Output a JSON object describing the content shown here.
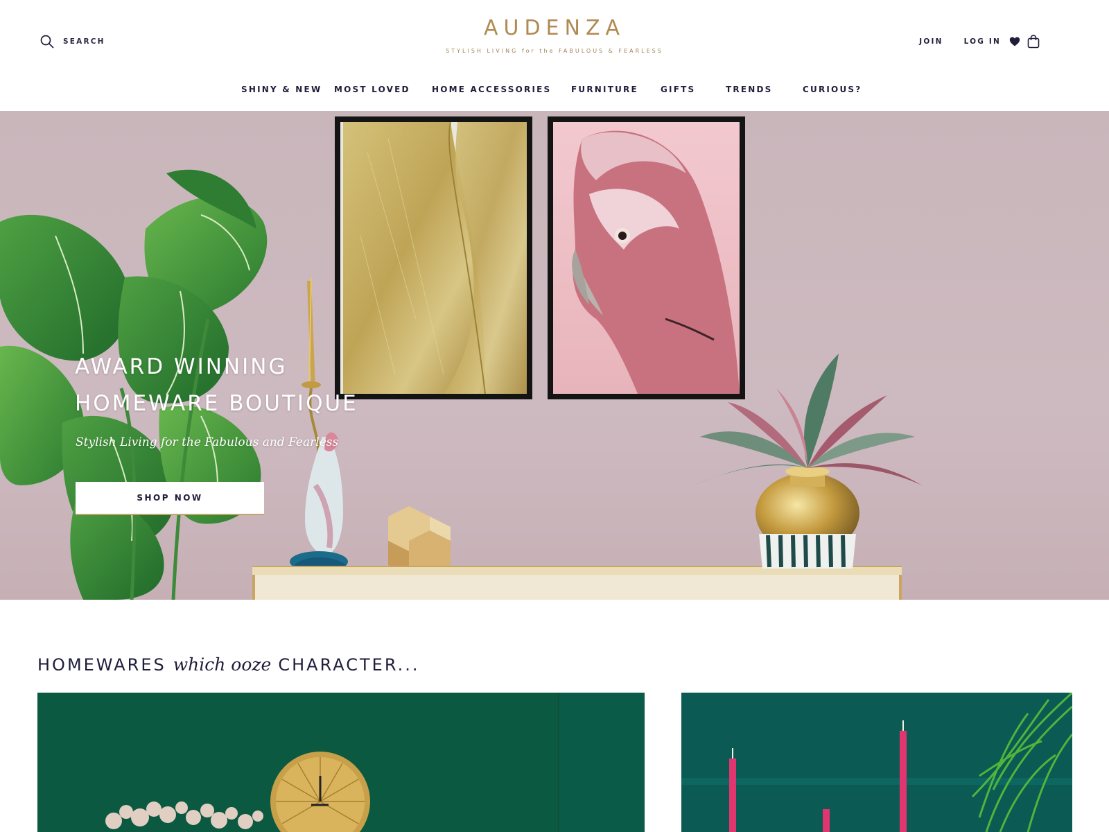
{
  "header": {
    "search_label": "SEARCH",
    "logo_text": "AUDENZA",
    "logo_tagline": "STYLISH LIVING for the FABULOUS & FEARLESS",
    "join_label": "JOIN",
    "login_label": "LOG IN"
  },
  "nav": [
    {
      "label": "SHINY & NEW"
    },
    {
      "label": "MOST LOVED"
    },
    {
      "label": "HOME ACCESSORIES"
    },
    {
      "label": "FURNITURE"
    },
    {
      "label": "GIFTS"
    },
    {
      "label": "TRENDS"
    },
    {
      "label": "CURIOUS?"
    }
  ],
  "hero": {
    "title_line1": "AWARD WINNING",
    "title_line2": "HOMEWARE BOUTIQUE",
    "subtitle": "Stylish Living for the Fabulous and Fearless",
    "cta_label": "SHOP NOW"
  },
  "section": {
    "title_part1": "HOMEWARES",
    "title_italic": "which ooze",
    "title_part2": "CHARACTER..."
  },
  "icons": {
    "search": "search-icon",
    "wishlist": "heart-icon",
    "cart": "shopping-bag-icon"
  },
  "colors": {
    "brand_gold": "#b08a52",
    "navy_text": "#1f1d3a",
    "hero_wall": "#c9b6bb",
    "card_green_left": "#0b5940",
    "card_green_right": "#0b5a54"
  }
}
